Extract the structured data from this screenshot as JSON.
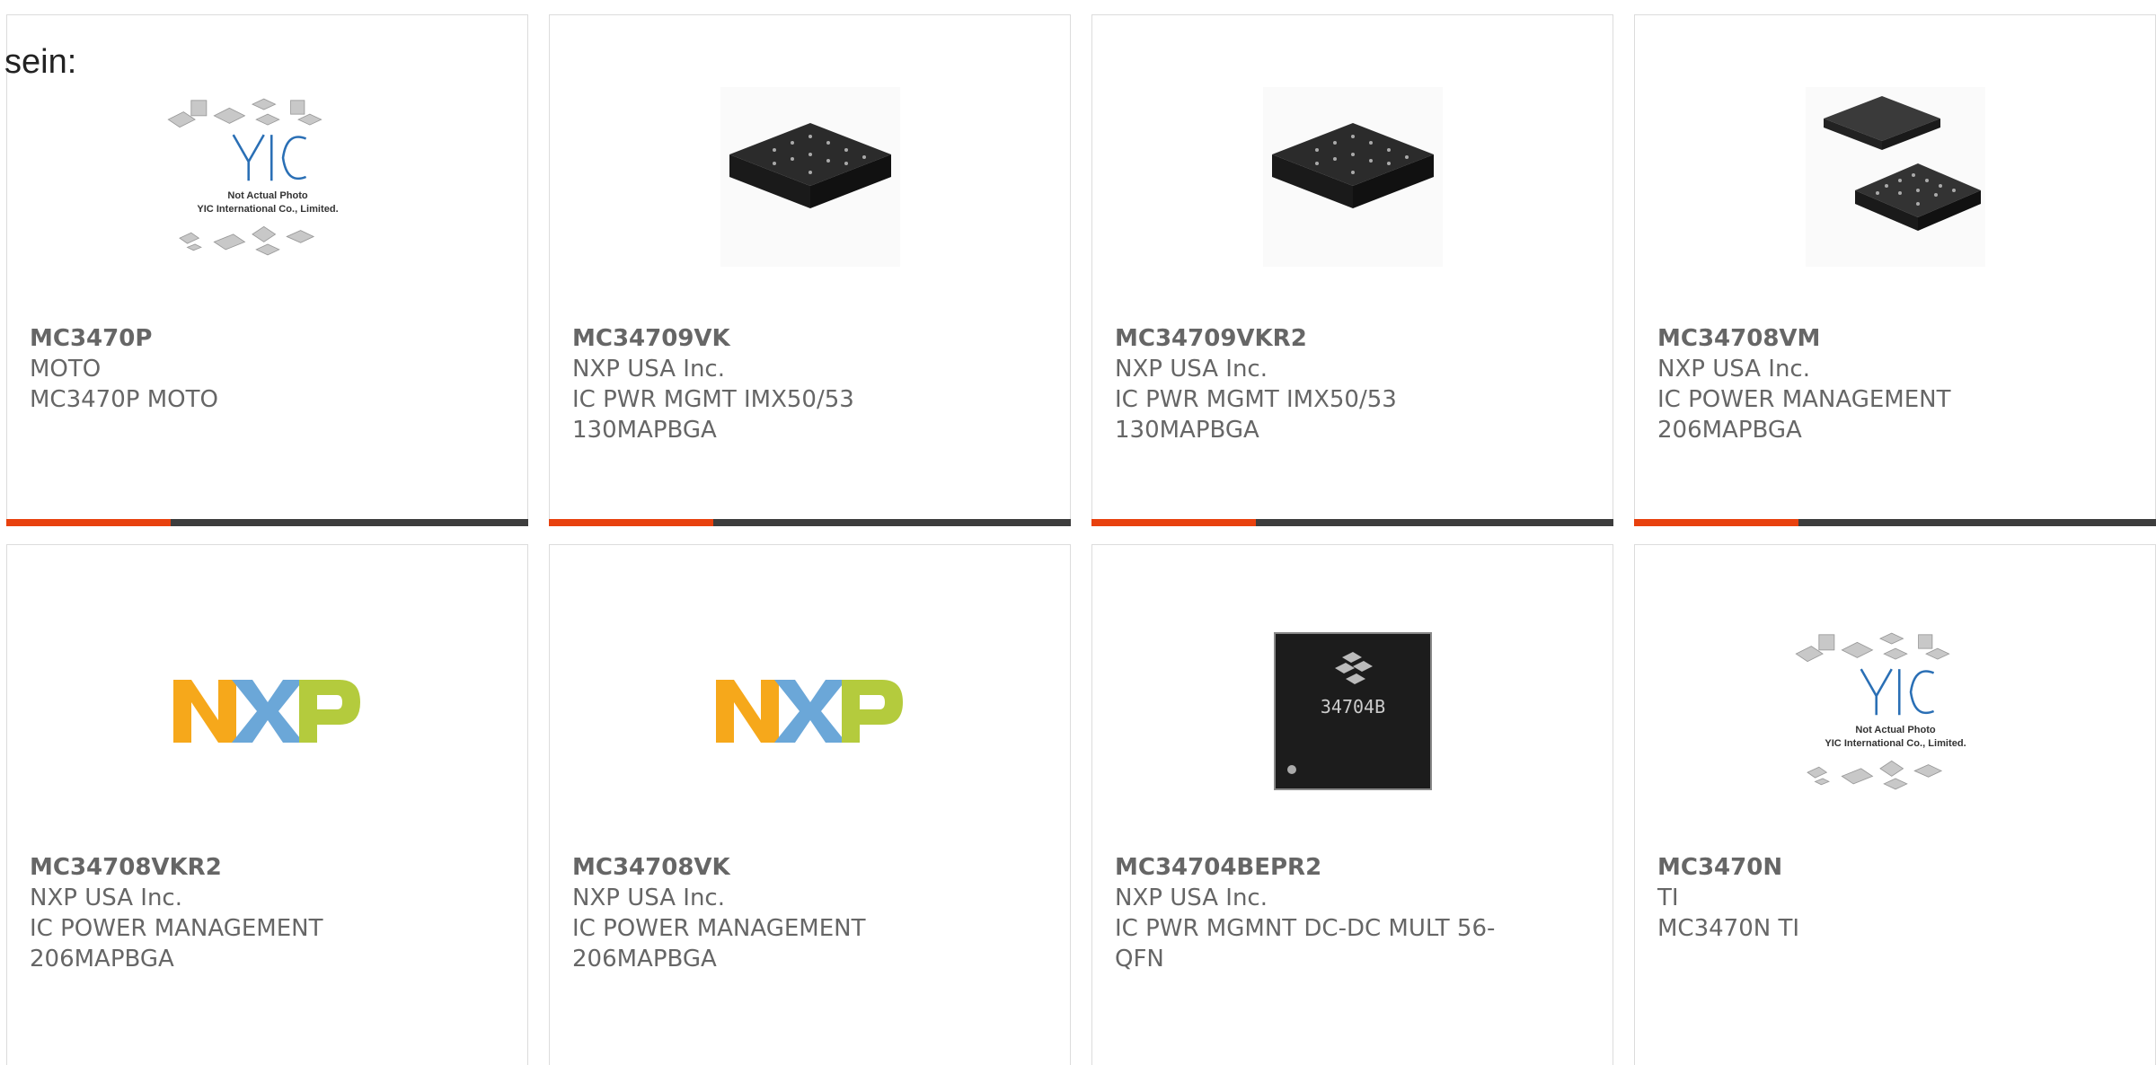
{
  "prefix_text": "sein:",
  "products": [
    {
      "part": "MC3470P",
      "maker": "MOTO",
      "desc": "MC3470P MOTO",
      "image": "not-actual-photo"
    },
    {
      "part": "MC34709VK",
      "maker": "NXP USA Inc.",
      "desc": "IC PWR MGMT IMX50/53 130MAPBGA",
      "image": "bga-chip"
    },
    {
      "part": "MC34709VKR2",
      "maker": "NXP USA Inc.",
      "desc": "IC PWR MGMT IMX50/53 130MAPBGA",
      "image": "bga-chip"
    },
    {
      "part": "MC34708VM",
      "maker": "NXP USA Inc.",
      "desc": "IC POWER MANAGEMENT 206MAPBGA",
      "image": "bga-chip-pair"
    },
    {
      "part": "MC34708VKR2",
      "maker": "NXP USA Inc.",
      "desc": "IC POWER MANAGEMENT 206MAPBGA",
      "image": "nxp-logo"
    },
    {
      "part": "MC34708VK",
      "maker": "NXP USA Inc.",
      "desc": "IC POWER MANAGEMENT 206MAPBGA",
      "image": "nxp-logo"
    },
    {
      "part": "MC34704BEPR2",
      "maker": "NXP USA Inc.",
      "desc": "IC PWR MGMNT DC-DC MULT 56-QFN",
      "image": "qfn-chip"
    },
    {
      "part": "MC3470N",
      "maker": "TI",
      "desc": "MC3470N TI",
      "image": "not-actual-photo"
    }
  ],
  "placeholder": {
    "line1": "Not Actual Photo",
    "line2": "YIC International Co., Limited.",
    "logo": "YIC"
  },
  "nxp_logo": {
    "letters": [
      "N",
      "X",
      "P"
    ]
  },
  "qfn_marking": "34704B",
  "colors": {
    "accent": "#e8410e",
    "bar": "#3d3d3d",
    "text": "#666666"
  }
}
